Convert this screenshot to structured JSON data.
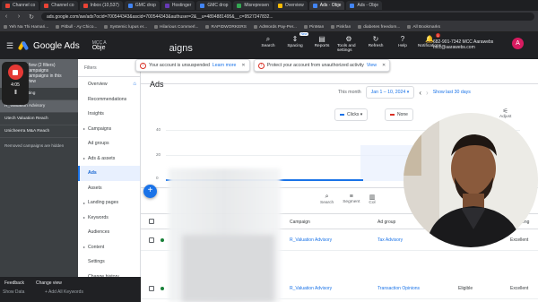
{
  "browser": {
    "tabs": [
      {
        "label": "Channel co",
        "color": "#ea4335",
        "active": false
      },
      {
        "label": "Channel co",
        "color": "#ea4335",
        "active": false
      },
      {
        "label": "Inbox (10,537)",
        "color": "#ea4335",
        "active": false
      },
      {
        "label": "GMC drop",
        "color": "#4285f4",
        "active": false
      },
      {
        "label": "Hostinger",
        "color": "#673ab7",
        "active": false
      },
      {
        "label": "GMC drop",
        "color": "#4285f4",
        "active": false
      },
      {
        "label": "Misrepresen",
        "color": "#34a853",
        "active": false
      },
      {
        "label": "Overview",
        "color": "#fbbc04",
        "active": false
      },
      {
        "label": "Ads · Obje",
        "color": "#4285f4",
        "active": true
      },
      {
        "label": "Ads - Obje",
        "color": "#4285f4",
        "active": false
      }
    ],
    "url": "ads.google.com/aw/ads?ocid=700544343&ascid=700544343&authuser=2&__u=4894881495&__c=9527247832...",
    "bookmarks": [
      "Yeh Na Thi Hamari...",
      "Pitbull - Ay Chico...",
      "Systemic lupus er...",
      "Hilarious Commerl...",
      "RAPIDWORKERS",
      "AdWords Pay-Per...",
      "PinMan",
      "Pinkfan",
      "diabetes freedom...",
      "All Bookmarks"
    ]
  },
  "header": {
    "menu_icon": "☰",
    "app_name": "Google Ads",
    "account_label": "MCC A",
    "account_name": "Obje",
    "page_title": "aigns",
    "tools": [
      {
        "label": "Search",
        "icon": "⌕",
        "badge": "",
        "tag": ""
      },
      {
        "label": "Spacing",
        "icon": "⇕",
        "badge": "",
        "tag": "New"
      },
      {
        "label": "Reports",
        "icon": "▤",
        "badge": "",
        "tag": ""
      },
      {
        "label": "Tools and settings",
        "icon": "⚙",
        "badge": "",
        "tag": ""
      },
      {
        "label": "Refresh",
        "icon": "↻",
        "badge": "",
        "tag": ""
      },
      {
        "label": "Help",
        "icon": "?",
        "badge": "",
        "tag": ""
      },
      {
        "label": "Notifications",
        "icon": "🔔",
        "badge": "1",
        "tag": ""
      }
    ],
    "customer_id": "682-901-7342 MCC Aarawebs",
    "customer_email": "mcc@aarawebs.com",
    "avatar_letter": "A"
  },
  "recorder": {
    "time": "4:05",
    "pause": "II"
  },
  "left_panel": {
    "top_line1": "View (2 filters)",
    "top_line2": "campaigns",
    "top_line3": "campaigns in this",
    "top_line4": "view",
    "rows": [
      "Vt_Remarketing",
      "R_Valuation Advisory",
      "Utech Valuation Reach",
      "Unicheerra M&A Reach"
    ],
    "selected_index": 1,
    "note": "Removed campaigns are hidden"
  },
  "nav": {
    "filters_label": "Filters",
    "items": [
      {
        "label": "Overview",
        "group": false
      },
      {
        "label": "Recommendations",
        "group": false
      },
      {
        "label": "Insights",
        "group": false
      },
      {
        "label": "Campaigns",
        "group": true
      },
      {
        "label": "Ad groups",
        "group": false
      },
      {
        "label": "Ads & assets",
        "group": true
      },
      {
        "label": "Ads",
        "group": false,
        "active": true
      },
      {
        "label": "Assets",
        "group": false
      },
      {
        "label": "Landing pages",
        "group": true
      },
      {
        "label": "Keywords",
        "group": true
      },
      {
        "label": "Audiences",
        "group": false
      },
      {
        "label": "Content",
        "group": true
      },
      {
        "label": "Settings",
        "group": false
      },
      {
        "label": "Change history",
        "group": false
      }
    ]
  },
  "alerts": [
    {
      "text": "Your account is unsuspended",
      "link": "Learn more"
    },
    {
      "text": "Protect your account from unauthorized activity",
      "link": "View"
    }
  ],
  "main": {
    "title": "Ads",
    "date_prefix": "This month",
    "date_range": "Jan 1 – 10, 2024",
    "show_last": "Show last 30 days",
    "metric1": "Clicks",
    "metric1_color": "#1a73e8",
    "metric2": "None",
    "metric2_color": "#d93025",
    "adjust_label": "Adjust",
    "axis_ticks": [
      "40",
      "20",
      "0"
    ],
    "fab": "+",
    "table_tools": [
      {
        "label": "Search",
        "icon": "⌕"
      },
      {
        "label": "Segment",
        "icon": "≡"
      },
      {
        "label": "Col",
        "icon": "▥"
      }
    ],
    "columns": [
      "Campaign",
      "Ad group",
      "Ad streng"
    ],
    "rows": [
      {
        "campaign": "R_Valuation Advisory",
        "ad_group": "Tax Advisory",
        "strength": "Excellent",
        "status": ""
      },
      {
        "campaign": "R_Valuation Advisory",
        "ad_group": "Transaction Opinions",
        "strength": "Excellent",
        "status": "Eligible"
      }
    ]
  },
  "footer": {
    "feedback": "Feedback",
    "change_view": "Change view",
    "hint": "Show Data",
    "add": "+ Add All Keywords"
  }
}
